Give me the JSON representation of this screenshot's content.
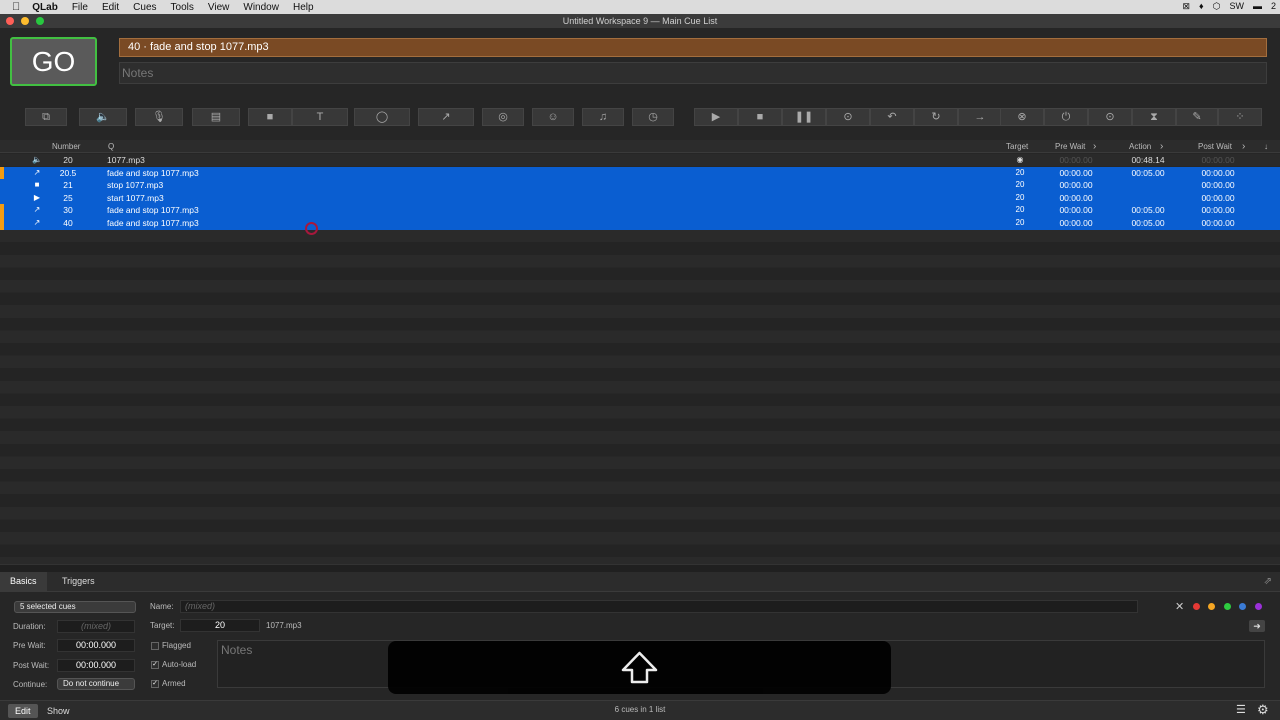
{
  "menubar": {
    "apple": "",
    "app": "QLab",
    "items": [
      "File",
      "Edit",
      "Cues",
      "Tools",
      "View",
      "Window",
      "Help"
    ],
    "tray": [
      "⊠",
      "♦",
      "⬡",
      "SW",
      "▬",
      "2"
    ]
  },
  "window": {
    "title": "Untitled Workspace 9 — Main Cue List"
  },
  "go_label": "GO",
  "current_cue": "40 · fade and stop 1077.mp3",
  "notes_placeholder": "Notes",
  "toolbar_icons": [
    "group-icon",
    "audio-icon",
    "mic-icon",
    "video-icon",
    "camera-icon",
    "text-icon",
    "light-icon",
    "fade-icon",
    "network-icon",
    "midi-icon",
    "music-icon",
    "timecode-icon",
    "start-icon",
    "stop-icon",
    "pause-icon",
    "load-icon",
    "reset-icon",
    "devamp-icon",
    "goto-icon",
    "target-icon",
    "arm-icon",
    "disarm-icon",
    "wait-icon",
    "memo-icon",
    "script-icon"
  ],
  "toolbar_glyphs": [
    "⧉",
    "🔈",
    "🎙",
    "▤",
    "■",
    "T",
    "◯",
    "↗",
    "◎",
    "☺",
    "♫",
    "◷",
    "▶",
    "■",
    "❚❚",
    "⊙",
    "↶",
    "↻",
    "→",
    "⊗",
    "⏻",
    "⊙",
    "⧗",
    "✎",
    "⁘"
  ],
  "table": {
    "headers": {
      "number": "Number",
      "q": "Q",
      "target": "Target",
      "pre_wait": "Pre Wait",
      "action": "Action",
      "post_wait": "Post Wait"
    },
    "rows": [
      {
        "icon": "🔈",
        "number": "20",
        "q": "1077.mp3",
        "target": "◉",
        "pre": "00:00.00",
        "action": "00:48.14",
        "post": "00:00.00",
        "selected": false,
        "flag": false
      },
      {
        "icon": "↗",
        "number": "20.5",
        "q": "fade and stop 1077.mp3",
        "target": "20",
        "pre": "00:00.00",
        "action": "00:05.00",
        "post": "00:00.00",
        "selected": true,
        "flag": true
      },
      {
        "icon": "■",
        "number": "21",
        "q": "stop 1077.mp3",
        "target": "20",
        "pre": "00:00.00",
        "action": "",
        "post": "00:00.00",
        "selected": true,
        "flag": false
      },
      {
        "icon": "▶",
        "number": "25",
        "q": "start 1077.mp3",
        "target": "20",
        "pre": "00:00.00",
        "action": "",
        "post": "00:00.00",
        "selected": true,
        "flag": false
      },
      {
        "icon": "↗",
        "number": "30",
        "q": "fade and stop 1077.mp3",
        "target": "20",
        "pre": "00:00.00",
        "action": "00:05.00",
        "post": "00:00.00",
        "selected": true,
        "flag": true
      },
      {
        "icon": "↗",
        "number": "40",
        "q": "fade and stop 1077.mp3",
        "target": "20",
        "pre": "00:00.00",
        "action": "00:05.00",
        "post": "00:00.00",
        "selected": true,
        "flag": true
      }
    ]
  },
  "inspector": {
    "tabs": [
      "Basics",
      "Triggers"
    ],
    "selection_popup": "5 selected cues",
    "duration_label": "Duration:",
    "duration_value": "(mixed)",
    "prewait_label": "Pre Wait:",
    "prewait_value": "00:00.000",
    "postwait_label": "Post Wait:",
    "postwait_value": "00:00.000",
    "continue_label": "Continue:",
    "continue_value": "Do not continue",
    "name_label": "Name:",
    "name_value": "(mixed)",
    "target_label": "Target:",
    "target_value": "20",
    "target_file": "1077.mp3",
    "flagged_label": "Flagged",
    "autoload_label": "Auto-load",
    "armed_label": "Armed",
    "notes_placeholder": "Notes",
    "colors": [
      "#e53935",
      "#f5a623",
      "#2ecc40",
      "#3a7bd5",
      "#9b30d9"
    ]
  },
  "status": {
    "edit": "Edit",
    "show": "Show",
    "summary": "6 cues in 1 list"
  }
}
